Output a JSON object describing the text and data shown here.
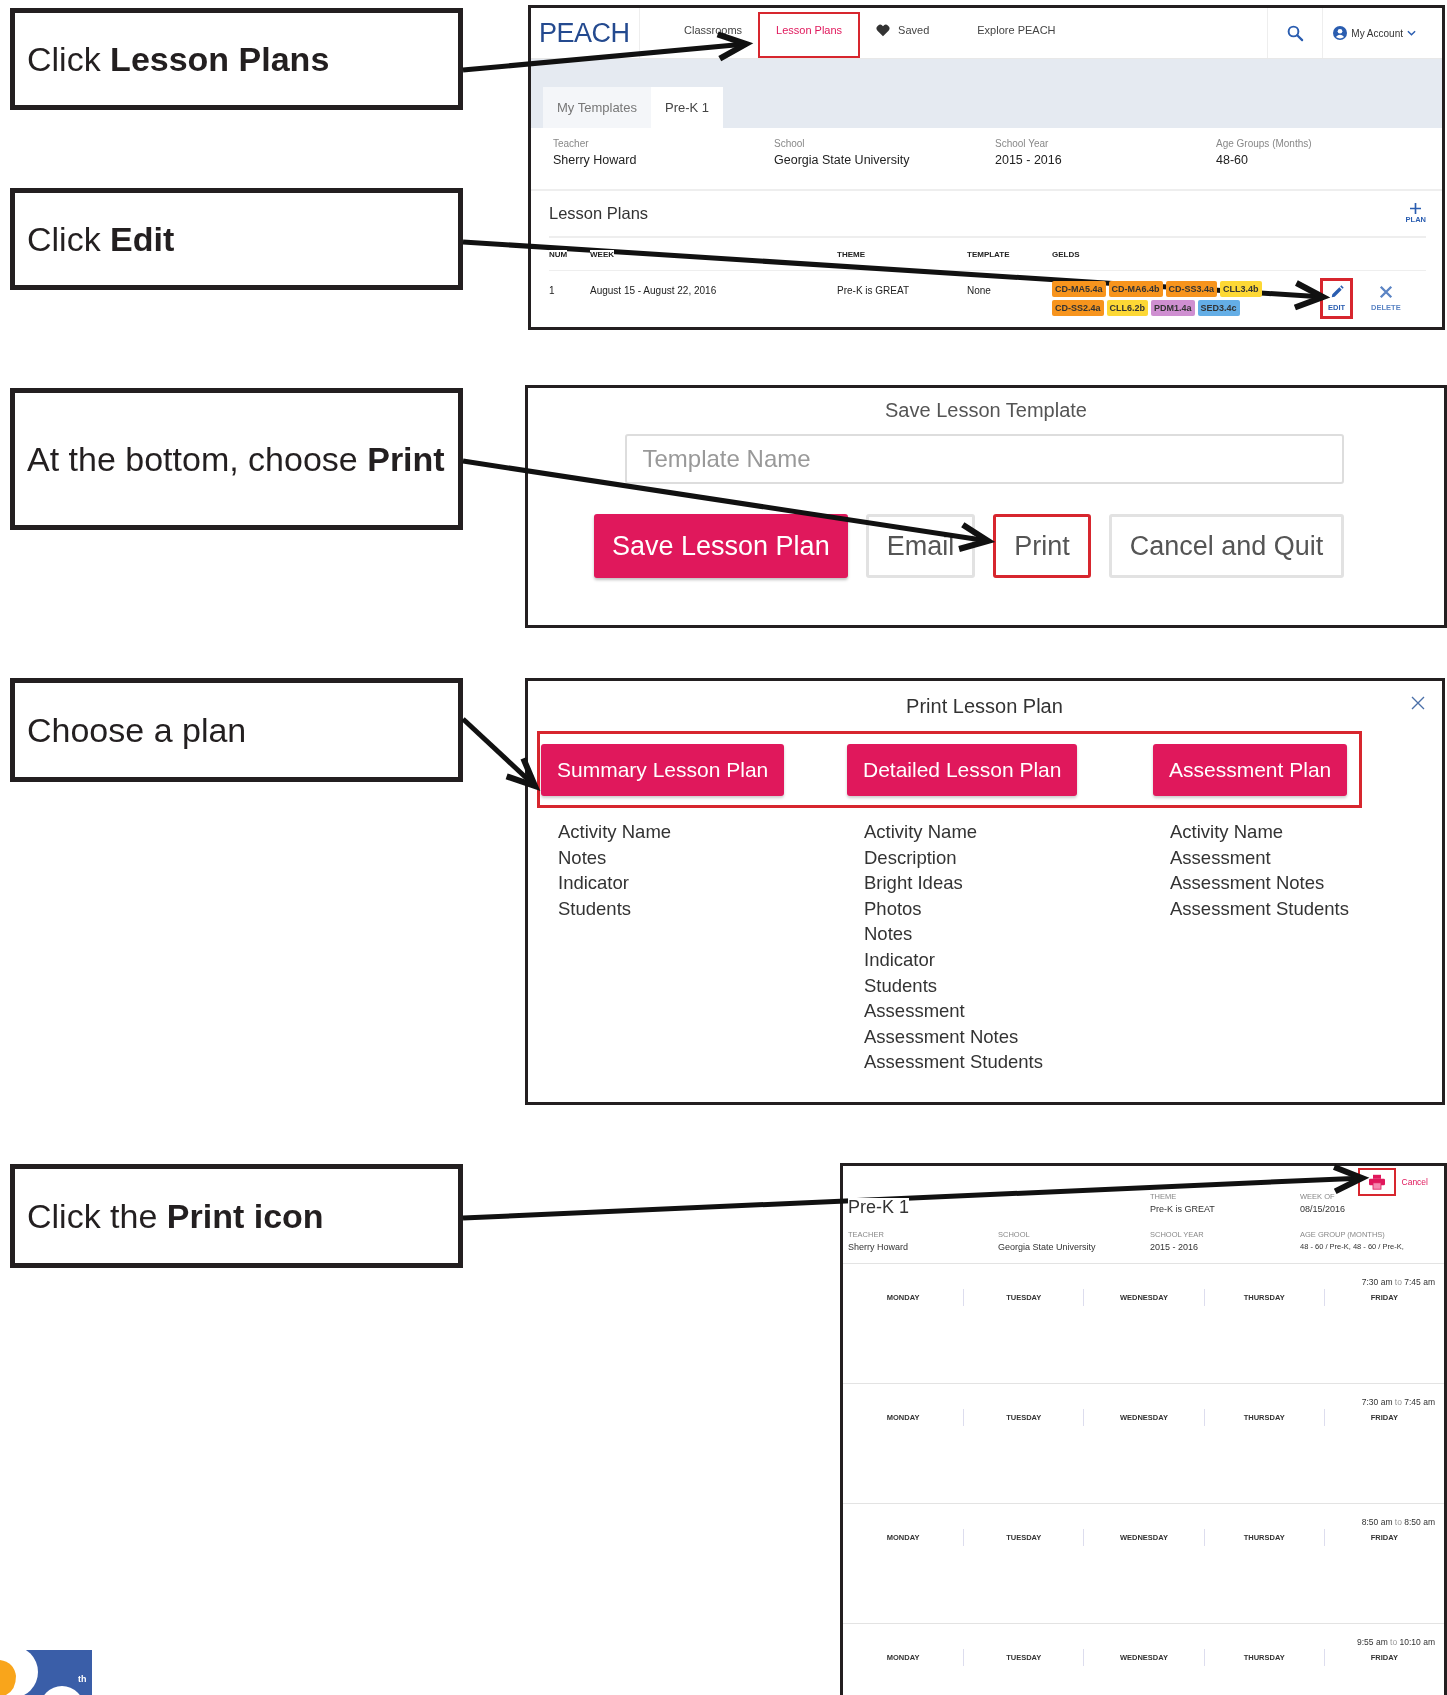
{
  "steps": [
    {
      "instruction": "Click **Lesson Plans**"
    },
    {
      "instruction": "Click **Edit**"
    },
    {
      "instruction": "At the bottom, choose **Print**"
    },
    {
      "instruction": "Choose a plan"
    },
    {
      "instruction": "Click the **Print icon**"
    }
  ],
  "lesson_plans_screen": {
    "logo": "PEACH",
    "nav": [
      {
        "label": "Classrooms",
        "kind": "link",
        "selected": false,
        "highlighted": false
      },
      {
        "label": "Lesson Plans",
        "kind": "link",
        "selected": true,
        "highlighted": true
      },
      {
        "label": "Saved",
        "kind": "heart",
        "selected": false,
        "highlighted": false
      },
      {
        "label": "Explore PEACH",
        "kind": "link",
        "selected": false,
        "highlighted": false
      }
    ],
    "account": "My Account",
    "tabs": [
      {
        "label": "My Templates",
        "selected": false
      },
      {
        "label": "Pre-K 1",
        "selected": true
      }
    ],
    "info": [
      {
        "label": "Teacher",
        "value": "Sherry Howard"
      },
      {
        "label": "School",
        "value": "Georgia State University"
      },
      {
        "label": "School Year",
        "value": "2015 - 2016"
      },
      {
        "label": "Age Groups (Months)",
        "value": "48-60"
      }
    ],
    "section_title": "Lesson Plans",
    "add_label": "PLAN",
    "columns": [
      "NUM",
      "WEEK",
      "THEME",
      "TEMPLATE",
      "GELDS"
    ],
    "rows": [
      {
        "num": "1",
        "week": "August 15 - August 22, 2016",
        "theme": "Pre-K is GREAT",
        "template": "None",
        "gelds_lines": [
          {
            "tags": [
              {
                "code": "CD-MA5.4a",
                "color": "#f7941d"
              },
              {
                "code": "CD-MA6.4b",
                "color": "#f7941d"
              },
              {
                "code": "CD-SS3.4a",
                "color": "#f7941d"
              },
              {
                "code": "CLL3.4b",
                "color": "#fdd835"
              }
            ]
          },
          {
            "tags": [
              {
                "code": "CD-SS2.4a",
                "color": "#f7941d"
              },
              {
                "code": "CLL6.2b",
                "color": "#fdd835"
              },
              {
                "code": "PDM1.4a",
                "color": "#cf8fd1"
              },
              {
                "code": "SED3.4c",
                "color": "#64aee6"
              }
            ]
          }
        ],
        "actions": [
          {
            "label": "EDIT",
            "kind": "edit",
            "highlighted": true
          },
          {
            "label": "DELETE",
            "kind": "delete",
            "highlighted": false
          }
        ]
      }
    ]
  },
  "save_dialog": {
    "title": "Save Lesson Template",
    "name_field": {
      "placeholder": "Template Name"
    },
    "buttons": [
      {
        "label": "Save Lesson Plan",
        "kind": "save",
        "highlighted": false
      },
      {
        "label": "Email",
        "kind": "email",
        "highlighted": false
      },
      {
        "label": "Print",
        "kind": "print",
        "highlighted": true
      },
      {
        "label": "Cancel and Quit",
        "kind": "cancel",
        "highlighted": false
      }
    ]
  },
  "print_dialog": {
    "title": "Print Lesson Plan",
    "options_highlighted": true,
    "options": [
      {
        "label": "Summary Lesson Plan",
        "contents": [
          "Activity Name",
          "Notes",
          "Indicator",
          "Students"
        ]
      },
      {
        "label": "Detailed Lesson Plan",
        "contents": [
          "Activity Name",
          "Description",
          "Bright Ideas",
          "Photos",
          "Notes",
          "Indicator",
          "Students",
          "Assessment",
          "Assessment Notes",
          "Assessment Students"
        ]
      },
      {
        "label": "Assessment Plan",
        "contents": [
          "Activity Name",
          "Assessment",
          "Assessment Notes",
          "Assessment Students"
        ]
      }
    ]
  },
  "print_preview": {
    "print_highlighted": true,
    "cancel": "Cancel",
    "title": "Pre-K 1",
    "meta": [
      {
        "label": "THEME",
        "value": "Pre-K is GREAT"
      },
      {
        "label": "WEEK OF",
        "value": "08/15/2016"
      },
      {
        "label": "TEACHER",
        "value": "Sherry Howard"
      },
      {
        "label": "SCHOOL",
        "value": "Georgia State University"
      },
      {
        "label": "SCHOOL YEAR",
        "value": "2015 - 2016"
      },
      {
        "label": "AGE GROUP (MONTHS)",
        "value": "48 - 60 / Pre-K, 48 - 60 / Pre-K,"
      }
    ],
    "blocks": [
      {
        "start": "7:30 am",
        "separator": "to",
        "end": "7:45 am",
        "days": [
          "MONDAY",
          "TUESDAY",
          "WEDNESDAY",
          "THURSDAY",
          "FRIDAY"
        ]
      },
      {
        "start": "7:30 am",
        "separator": "to",
        "end": "7:45 am",
        "days": [
          "MONDAY",
          "TUESDAY",
          "WEDNESDAY",
          "THURSDAY",
          "FRIDAY"
        ]
      },
      {
        "start": "8:50 am",
        "separator": "to",
        "end": "8:50 am",
        "days": [
          "MONDAY",
          "TUESDAY",
          "WEDNESDAY",
          "THURSDAY",
          "FRIDAY"
        ]
      },
      {
        "start": "9:55 am",
        "separator": "to",
        "end": "10:10 am",
        "days": [
          "MONDAY",
          "TUESDAY",
          "WEDNESDAY",
          "THURSDAY",
          "FRIDAY"
        ]
      }
    ]
  },
  "logo_fragment": {
    "text": "th"
  }
}
